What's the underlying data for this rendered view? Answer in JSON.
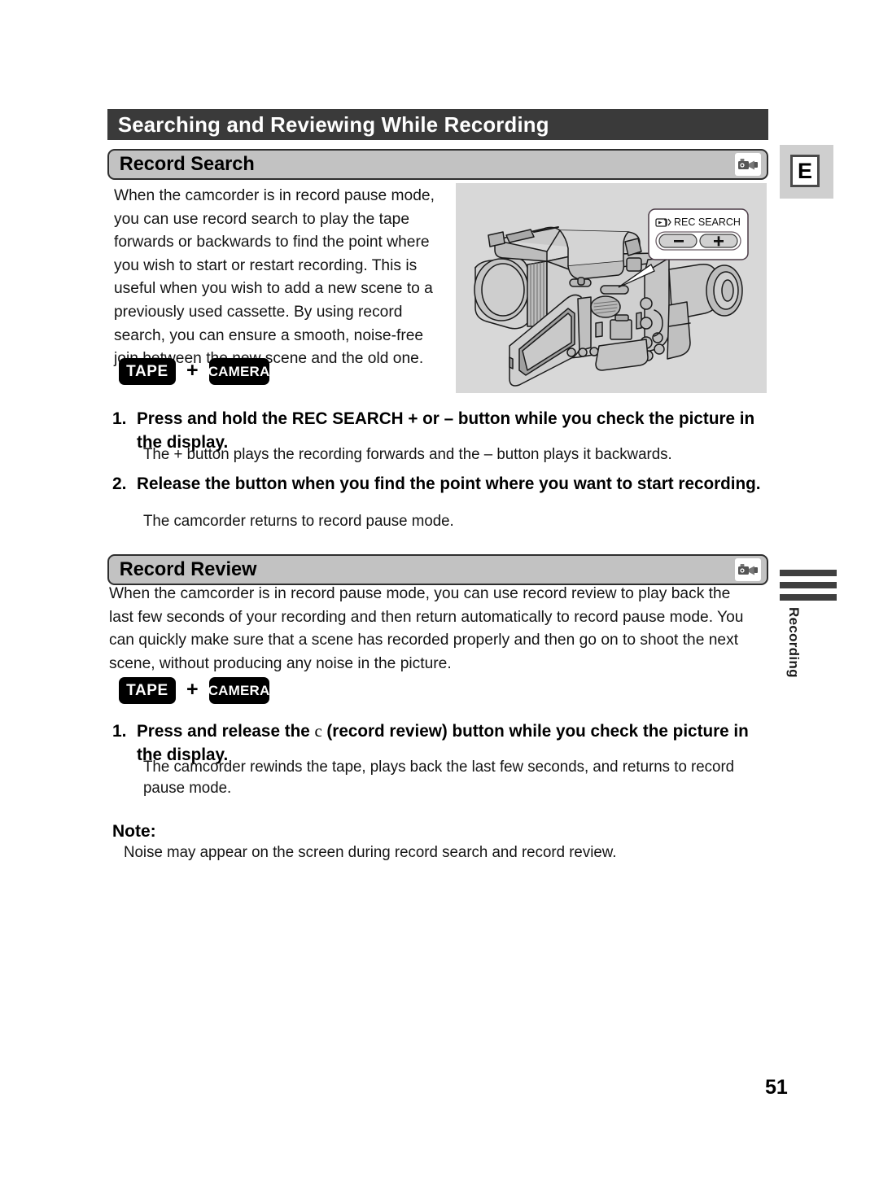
{
  "page": {
    "chapter_title": "Searching and Reviewing While Recording",
    "page_number": "51",
    "language_tab": "E",
    "thumb_index_label": "Recording"
  },
  "sections": [
    {
      "id": "record-search",
      "heading": "Record Search",
      "icon": "camcorder-icon",
      "intro": "When the camcorder is in record pause mode, you can use record search to play the tape forwards or backwards to find the point where you wish to start or restart recording. This is useful when you wish to add a new scene to a previously used cassette. By using record search, you can ensure a smooth, noise-free join between the new scene and the old one.",
      "modes": {
        "tape": "TAPE",
        "plus": "+",
        "camera": "CAMERA"
      },
      "steps": [
        {
          "number": "1.",
          "text": "Press and hold the REC SEARCH + or – button while you check the picture in the display.",
          "detail": "The + button plays the recording forwards and the – button plays it backwards."
        },
        {
          "number": "2.",
          "text": "Release the button when you find the point where you want to start recording.",
          "detail": "The camcorder returns to record pause mode."
        }
      ]
    },
    {
      "id": "record-review",
      "heading": "Record Review",
      "icon": "camcorder-icon",
      "intro": "When the camcorder is in record pause mode, you can use record review to play back the last few seconds of your recording and then return automatically to record pause mode. You can quickly make sure that a scene has recorded properly and then go on to shoot the next scene, without producing any noise in the picture.",
      "modes": {
        "tape": "TAPE",
        "plus": "+",
        "camera": "CAMERA"
      },
      "steps": [
        {
          "number": "1.",
          "text_before": "Press and release the ",
          "symbol": "c",
          "text_after": " (record review) button while you check the picture in the display.",
          "detail": "The camcorder rewinds the tape, plays back the last few seconds, and returns to record pause mode."
        }
      ]
    }
  ],
  "note": {
    "title": "Note:",
    "body": "Noise may appear on the screen during record search and record review."
  },
  "illustration": {
    "description": "camcorder-line-drawing",
    "callout": {
      "icon": "rec-search-tape-icon",
      "label": "REC SEARCH",
      "minus_button": "–",
      "plus_button": "+"
    }
  },
  "colors": {
    "chapter_bar": "#3a3a3a",
    "section_bar": "#c2c2c2",
    "illustration_bg": "#d8d8d8",
    "badge_bg": "#000000",
    "tab_bg": "#cfcfcf"
  }
}
